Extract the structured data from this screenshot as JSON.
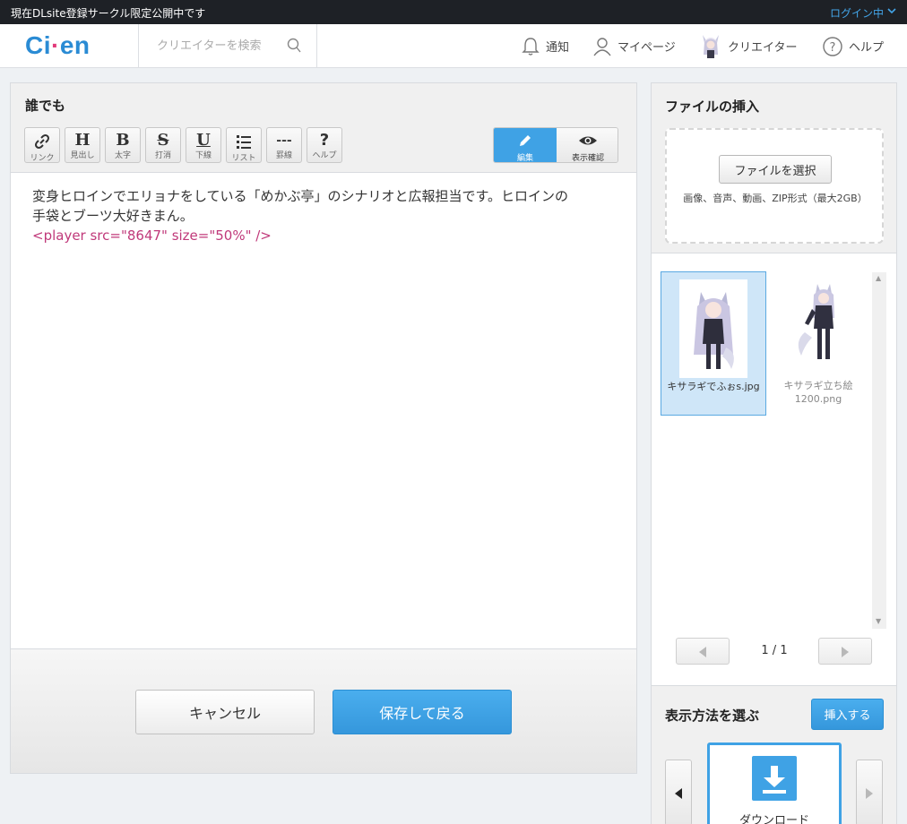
{
  "topbar": {
    "notice": "現在DLsite登録サークル限定公開中です",
    "login_status": "ログイン中"
  },
  "header": {
    "logo": {
      "part1": "Ci",
      "part2": "·",
      "part3": "en"
    },
    "search_placeholder": "クリエイターを検索",
    "nav": {
      "notifications": "通知",
      "mypage": "マイページ",
      "creator": "クリエイター",
      "help": "ヘルプ"
    }
  },
  "editor": {
    "title": "誰でも",
    "toolbar": [
      {
        "glyph": "🔗",
        "label": "リンク"
      },
      {
        "glyph": "H",
        "label": "見出し"
      },
      {
        "glyph": "B",
        "label": "太字"
      },
      {
        "glyph": "S",
        "label": "打消"
      },
      {
        "glyph": "U",
        "label": "下線"
      },
      {
        "glyph": "☰",
        "label": "リスト"
      },
      {
        "glyph": "---",
        "label": "罫線"
      },
      {
        "glyph": "?",
        "label": "ヘルプ"
      }
    ],
    "mode_edit_label": "編集",
    "mode_preview_label": "表示確認",
    "body_line1": "変身ヒロインでエリョナをしている「めかぶ亭」のシナリオと広報担当です。ヒロインの",
    "body_line2": "手袋とブーツ大好きまん。",
    "body_tag": "<player src=\"8647\" size=\"50%\" />",
    "cancel_label": "キャンセル",
    "save_label": "保存して戻る"
  },
  "sidebar": {
    "title": "ファイルの挿入",
    "choose_file_label": "ファイルを選択",
    "file_note": "画像、音声、動画、ZIP形式（最大2GB）",
    "files": [
      {
        "name": "キサラギでふぉs.jpg",
        "selected": true
      },
      {
        "name": "キサラギ立ち絵1200.png",
        "selected": false
      }
    ],
    "page_indicator": "1 / 1",
    "display_method_title": "表示方法を選ぶ",
    "insert_label": "挿入する",
    "display_option": "ダウンロード"
  },
  "colors": {
    "accent": "#3fa2e5",
    "tag": "#c0397a",
    "topbar": "#1e2126",
    "logo_blue": "#2a8bd4",
    "logo_pink": "#e23a7a"
  }
}
